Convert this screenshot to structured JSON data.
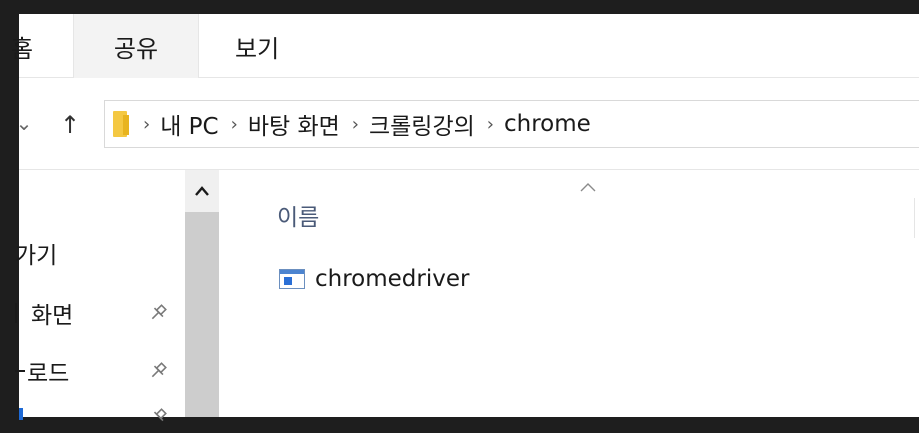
{
  "ribbon": {
    "tabs": [
      {
        "label": "홈"
      },
      {
        "label": "공유"
      },
      {
        "label": "보기"
      }
    ]
  },
  "nav_buttons": {
    "back_glyph": "⌄",
    "up_glyph": "↑"
  },
  "address": {
    "separator": "›",
    "crumbs": [
      "내 PC",
      "바탕 화면",
      "크롤링강의",
      "chrome"
    ]
  },
  "nav_pane": {
    "items": [
      {
        "label": "가기",
        "pinned": false
      },
      {
        "label": "화면",
        "pinned": true
      },
      {
        "label": "로드",
        "pinned": true
      }
    ],
    "pin_glyph": "📌"
  },
  "scroll": {
    "up_glyph": "^"
  },
  "content": {
    "column_name": "이름",
    "sort_glyph": "^",
    "files": [
      {
        "name": "chromedriver",
        "icon": "application-icon"
      }
    ]
  },
  "colors": {
    "background": "#1e1e1e",
    "window": "#ffffff",
    "column_header": "#4a5a78",
    "folder": "#f4c842"
  }
}
